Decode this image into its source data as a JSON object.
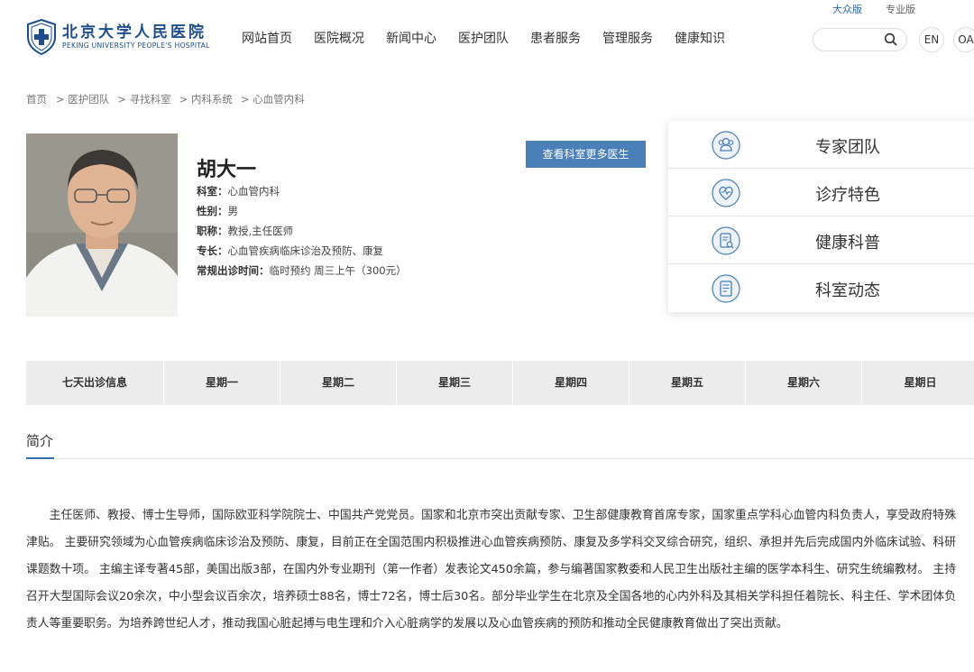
{
  "header": {
    "version_public": "大众版",
    "version_pro": "专业版",
    "logo_cn": "北京大学人民医院",
    "logo_en": "PEKING UNIVERSITY PEOPLE'S HOSPITAL",
    "nav": [
      "网站首页",
      "医院概况",
      "新闻中心",
      "医护团队",
      "患者服务",
      "管理服务",
      "健康知识"
    ],
    "search_placeholder": "",
    "lang_en": "EN",
    "oa": "OA"
  },
  "breadcrumb": [
    "首页",
    "> 医护团队",
    "> 寻找科室",
    "> 内科系统",
    "> 心血管内科"
  ],
  "doctor": {
    "name": "胡大一",
    "dept_label": "科室：",
    "dept": "心血管内科",
    "gender_label": "性别：",
    "gender": "男",
    "title_label": "职称：",
    "title": "教授,主任医师",
    "specialty_label": "专长：",
    "specialty": "心血管疾病临床诊治及预防、康复",
    "clinic_label": "常规出诊时间：",
    "clinic": "临时预约 周三上午（300元）",
    "more_button": "查看科室更多医生"
  },
  "side_menu": [
    {
      "label": "专家团队",
      "icon": "team-icon"
    },
    {
      "label": "诊疗特色",
      "icon": "heart-shield-icon"
    },
    {
      "label": "健康科普",
      "icon": "document-search-icon"
    },
    {
      "label": "科室动态",
      "icon": "news-icon"
    }
  ],
  "schedule": {
    "header": [
      "七天出诊信息",
      "星期一",
      "星期二",
      "星期三",
      "星期四",
      "星期五",
      "星期六",
      "星期日"
    ]
  },
  "intro": {
    "title": "简介",
    "text": "主任医师、教授、博士生导师，国际欧亚科学院院士、中国共产党党员。国家和北京市突出贡献专家、卫生部健康教育首席专家，国家重点学科心血管内科负责人，享受政府特殊津贴。 主要研究领域为心血管疾病临床诊治及预防、康复，目前正在全国范围内积极推进心血管疾病预防、康复及多学科交叉综合研究，组织、承担并先后完成国内外临床试验、科研课题数十项。 主编主译专著45部，美国出版3部，在国内外专业期刊（第一作者）发表论文450余篇，参与编著国家教委和人民卫生出版社主编的医学本科生、研究生统编教材。 主持召开大型国际会议20余次，中小型会议百余次，培养硕士88名，博士72名，博士后30名。部分毕业学生在北京及全国各地的心内外科及其相关学科担任着院长、科主任、学术团体负责人等重要职务。为培养跨世纪人才，推动我国心脏起搏与电生理和介入心脏病学的发展以及心血管疾病的预防和推动全民健康教育做出了突出贡献。"
  },
  "colors": {
    "brand": "#1e4e8c",
    "accent": "#4b7fb8",
    "schedule_bg": "#ececec"
  }
}
